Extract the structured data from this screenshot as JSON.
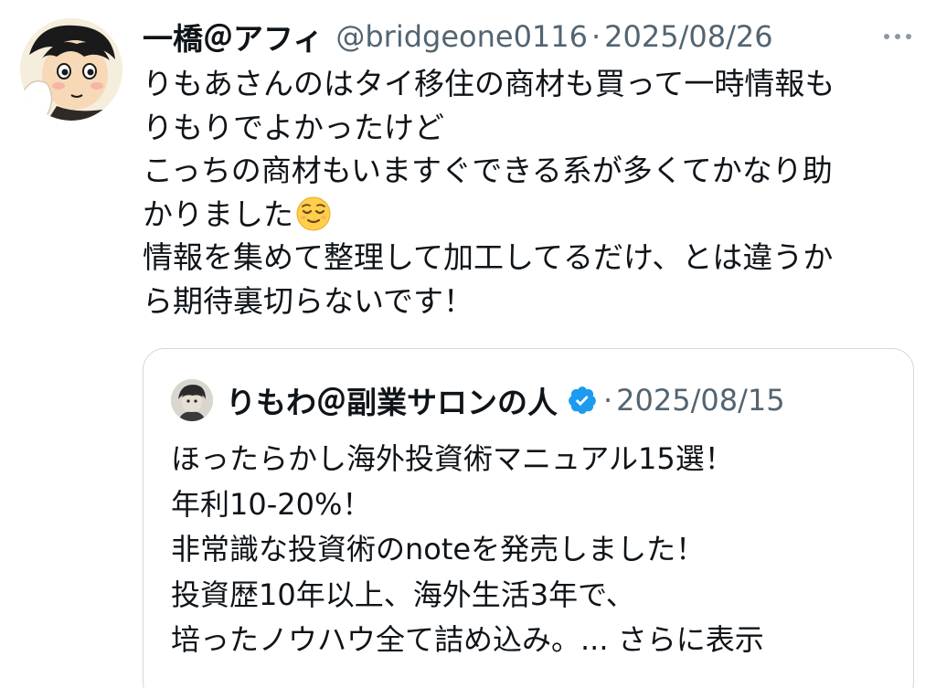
{
  "tweet": {
    "display_name": "一橋＠アフィ",
    "handle": "@bridgeone0116",
    "separator": "·",
    "date": "2025/08/26",
    "avatar_icon": "user-avatar-anime",
    "more_icon": "more-options-icon",
    "lines": [
      "りもあさんのはタイ移住の商材も買って一時情報も",
      "りもりでよかったけど",
      "こっちの商材もいますぐできる系が多くてかなり助",
      "かりました",
      "情報を集めて整理して加工してるだけ、とは違うか",
      "ら期待裏切らないです！"
    ],
    "emoji": "relieved-face-emoji"
  },
  "quote": {
    "display_name": "りもわ＠副業サロンの人",
    "verified_icon": "verified-badge-icon",
    "separator": "·",
    "date": "2025/08/15",
    "lines": [
      "ほったらかし海外投資術マニュアル15選！",
      "年利10-20%！",
      "非常識な投資術のnoteを発売しました！",
      "投資歴10年以上、海外生活3年で、",
      "培ったノウハウ全て詰め込み。..."
    ],
    "show_more": "さらに表示"
  },
  "colors": {
    "text": "#0f1419",
    "secondary": "#536471",
    "border": "#cfd9de",
    "verified": "#1d9bf0"
  }
}
